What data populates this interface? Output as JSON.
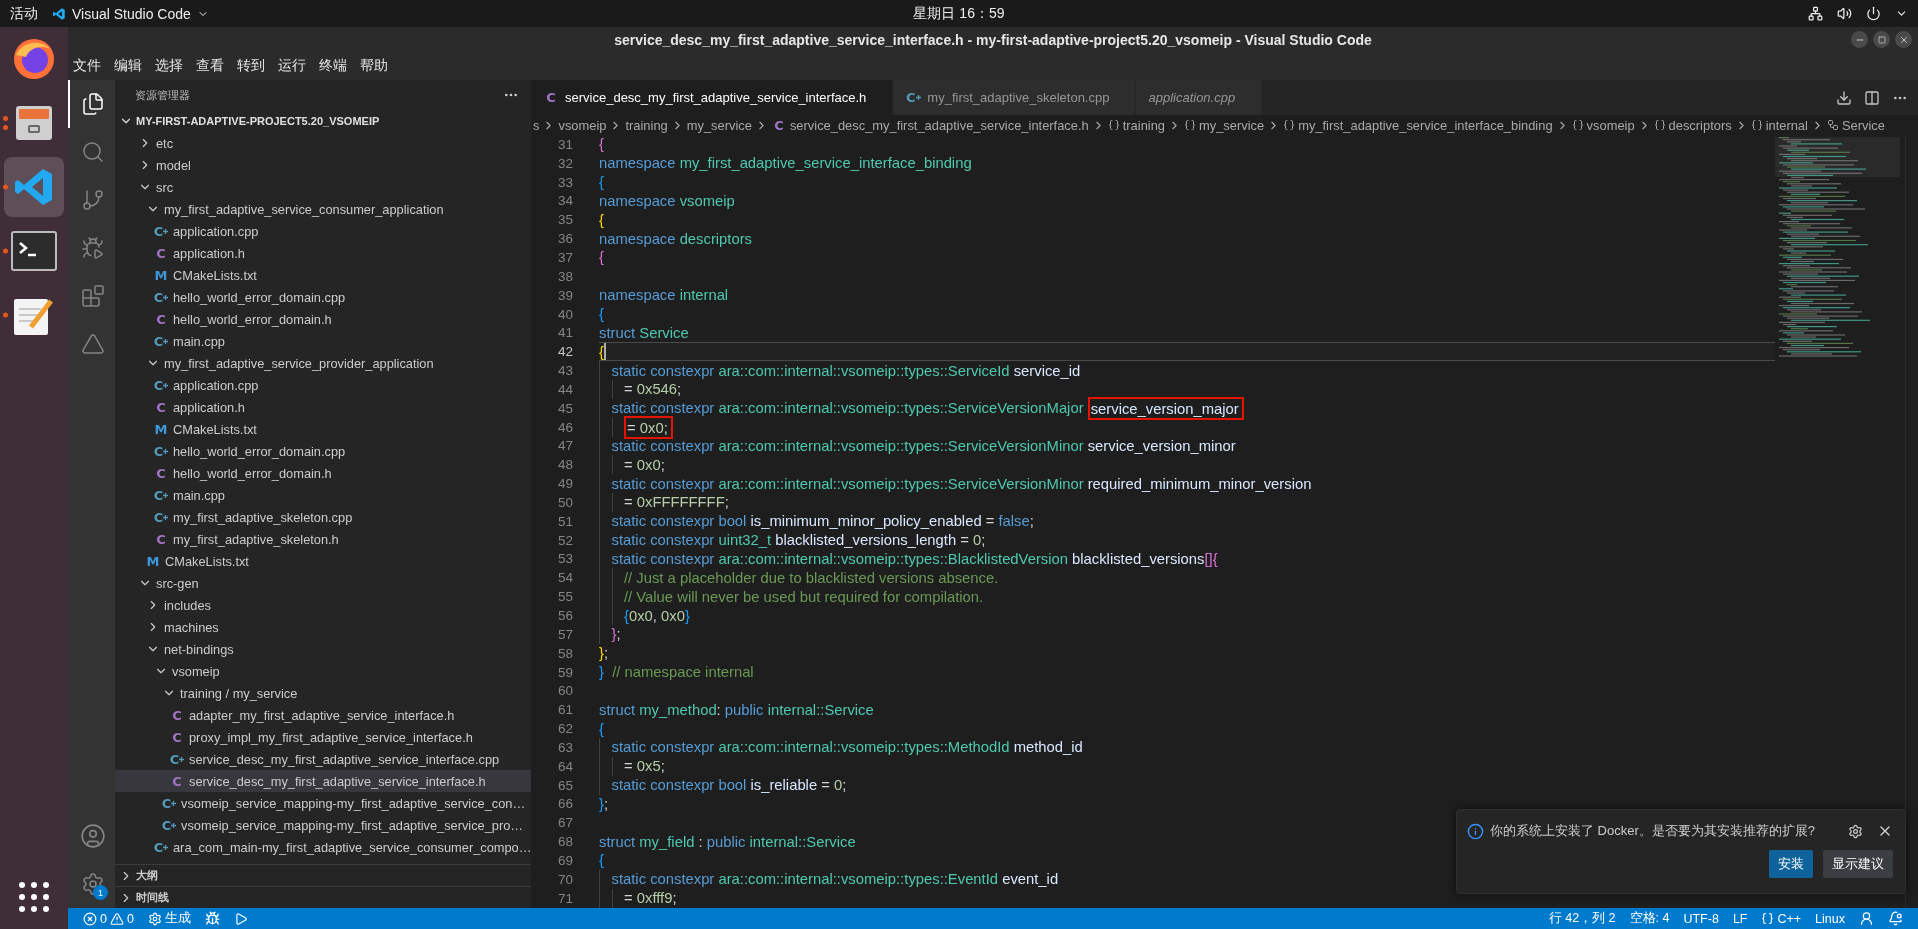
{
  "top_bar": {
    "activities": "活动",
    "app_name": "Visual Studio Code",
    "clock": "星期日 16：59"
  },
  "dock": [
    {
      "kind": "firefox",
      "selected": false,
      "running": false
    },
    {
      "kind": "files",
      "selected": false,
      "running": true,
      "multiple_windows": true
    },
    {
      "kind": "vscode",
      "selected": true,
      "running": true,
      "multiple_windows": false
    },
    {
      "kind": "terminal",
      "selected": false,
      "running": true,
      "multiple_windows": false
    },
    {
      "kind": "editor",
      "selected": false,
      "running": true,
      "multiple_windows": false
    }
  ],
  "window": {
    "title": "service_desc_my_first_adaptive_service_interface.h - my-first-adaptive-project5.20_vsomeip - Visual Studio Code",
    "menu": [
      "文件",
      "编辑",
      "选择",
      "查看",
      "转到",
      "运行",
      "终端",
      "帮助"
    ]
  },
  "activity_bar": {
    "items": [
      {
        "kind": "explorer",
        "selected": true
      },
      {
        "kind": "search",
        "selected": false
      },
      {
        "kind": "source_control",
        "selected": false
      },
      {
        "kind": "run_debug",
        "selected": false
      },
      {
        "kind": "extensions",
        "selected": false
      },
      {
        "kind": "triangle",
        "selected": false
      }
    ],
    "manage_badge": "1"
  },
  "sidebar": {
    "title": "资源管理器",
    "root": "MY-FIRST-ADAPTIVE-PROJECT5.20_VSOMEIP",
    "root_expanded": true,
    "tree": [
      {
        "label": "etc",
        "kind": "folder",
        "expanded": false,
        "selected": false
      },
      {
        "label": "model",
        "kind": "folder",
        "expanded": false,
        "selected": false
      },
      {
        "label": "src",
        "kind": "folder",
        "expanded": true,
        "selected": false,
        "children": [
          {
            "label": "my_first_adaptive_service_consumer_application",
            "kind": "folder",
            "expanded": true,
            "selected": false,
            "children": [
              {
                "label": "application.cpp",
                "kind": "cpp",
                "icon": "C",
                "selected": false
              },
              {
                "label": "application.h",
                "kind": "h",
                "icon": "C",
                "selected": false
              },
              {
                "label": "CMakeLists.txt",
                "kind": "cmake",
                "icon": "M",
                "selected": false
              },
              {
                "label": "hello_world_error_domain.cpp",
                "kind": "cpp",
                "icon": "C",
                "selected": false
              },
              {
                "label": "hello_world_error_domain.h",
                "kind": "h",
                "icon": "C",
                "selected": false
              },
              {
                "label": "main.cpp",
                "kind": "cpp",
                "icon": "C",
                "selected": false
              }
            ]
          },
          {
            "label": "my_first_adaptive_service_provider_application",
            "kind": "folder",
            "expanded": true,
            "selected": false,
            "children": [
              {
                "label": "application.cpp",
                "kind": "cpp",
                "icon": "C",
                "selected": false
              },
              {
                "label": "application.h",
                "kind": "h",
                "icon": "C",
                "selected": false
              },
              {
                "label": "CMakeLists.txt",
                "kind": "cmake",
                "icon": "M",
                "selected": false
              },
              {
                "label": "hello_world_error_domain.cpp",
                "kind": "cpp",
                "icon": "C",
                "selected": false
              },
              {
                "label": "hello_world_error_domain.h",
                "kind": "h",
                "icon": "C",
                "selected": false
              },
              {
                "label": "main.cpp",
                "kind": "cpp",
                "icon": "C",
                "selected": false
              },
              {
                "label": "my_first_adaptive_skeleton.cpp",
                "kind": "cpp",
                "icon": "C",
                "selected": false
              },
              {
                "label": "my_first_adaptive_skeleton.h",
                "kind": "h",
                "icon": "C",
                "selected": false
              }
            ]
          },
          {
            "label": "CMakeLists.txt",
            "kind": "cmake",
            "icon": "M",
            "selected": false
          }
        ]
      },
      {
        "label": "src-gen",
        "kind": "folder",
        "expanded": true,
        "selected": false,
        "children": [
          {
            "label": "includes",
            "kind": "folder",
            "expanded": false,
            "selected": false
          },
          {
            "label": "machines",
            "kind": "folder",
            "expanded": false,
            "selected": false
          },
          {
            "label": "net-bindings",
            "kind": "folder",
            "expanded": true,
            "selected": false,
            "children": [
              {
                "label": "vsomeip",
                "kind": "folder",
                "expanded": true,
                "selected": false,
                "children": [
                  {
                    "label": "training / my_service",
                    "kind": "folder",
                    "expanded": true,
                    "selected": false,
                    "children": [
                      {
                        "label": "adapter_my_first_adaptive_service_interface.h",
                        "kind": "h",
                        "icon": "C",
                        "selected": false
                      },
                      {
                        "label": "proxy_impl_my_first_adaptive_service_interface.h",
                        "kind": "h",
                        "icon": "C",
                        "selected": false
                      },
                      {
                        "label": "service_desc_my_first_adaptive_service_interface.cpp",
                        "kind": "cpp",
                        "icon": "C",
                        "selected": false
                      },
                      {
                        "label": "service_desc_my_first_adaptive_service_interface.h",
                        "kind": "h",
                        "icon": "C",
                        "selected": true
                      }
                    ]
                  },
                  {
                    "label": "vsomeip_service_mapping-my_first_adaptive_service_con…",
                    "kind": "cpp",
                    "icon": "C",
                    "selected": false
                  },
                  {
                    "label": "vsomeip_service_mapping-my_first_adaptive_service_pro…",
                    "kind": "cpp",
                    "icon": "C",
                    "selected": false
                  }
                ]
              },
              {
                "label": "ara_com_main-my_first_adaptive_service_consumer_compo…",
                "kind": "cpp",
                "icon": "C",
                "selected": false
              }
            ]
          }
        ]
      }
    ],
    "sections": [
      {
        "label": "大纲",
        "expanded": false
      },
      {
        "label": "时间线",
        "expanded": false
      }
    ]
  },
  "editor": {
    "tabs": [
      {
        "label": "service_desc_my_first_adaptive_service_interface.h",
        "kind": "h",
        "icon": "C",
        "selected": true,
        "preview": false
      },
      {
        "label": "my_first_adaptive_skeleton.cpp",
        "kind": "cpp",
        "icon": "C",
        "selected": false,
        "preview": false
      },
      {
        "label": "application.cpp",
        "kind": "cpp",
        "selected": false,
        "preview": true
      }
    ],
    "breadcrumbs": [
      {
        "label": "s",
        "kind": "folder"
      },
      {
        "label": "vsomeip",
        "kind": "folder"
      },
      {
        "label": "training",
        "kind": "folder"
      },
      {
        "label": "my_service",
        "kind": "folder"
      },
      {
        "label": "service_desc_my_first_adaptive_service_interface.h",
        "kind": "h_file",
        "icon": "C"
      },
      {
        "label": "training",
        "kind": "namespace"
      },
      {
        "label": "my_service",
        "kind": "namespace"
      },
      {
        "label": "my_first_adaptive_service_interface_binding",
        "kind": "namespace"
      },
      {
        "label": "vsomeip",
        "kind": "namespace"
      },
      {
        "label": "descriptors",
        "kind": "namespace"
      },
      {
        "label": "internal",
        "kind": "namespace"
      },
      {
        "label": "Service",
        "kind": "struct"
      }
    ],
    "lines": [
      {
        "number": "31",
        "current": false,
        "indented": false,
        "double_indented": false,
        "tokens": [
          {
            "kind": "br1",
            "text": "{"
          }
        ]
      },
      {
        "number": "32",
        "current": false,
        "indented": false,
        "double_indented": false,
        "tokens": [
          {
            "kind": "kw",
            "text": "namespace "
          },
          {
            "kind": "type",
            "text": "my_first_adaptive_service_interface_binding"
          }
        ]
      },
      {
        "number": "33",
        "current": false,
        "indented": false,
        "double_indented": false,
        "tokens": [
          {
            "kind": "br2",
            "text": "{"
          }
        ]
      },
      {
        "number": "34",
        "current": false,
        "indented": false,
        "double_indented": false,
        "tokens": [
          {
            "kind": "kw",
            "text": "namespace "
          },
          {
            "kind": "type",
            "text": "vsomeip"
          }
        ]
      },
      {
        "number": "35",
        "current": false,
        "indented": false,
        "double_indented": false,
        "tokens": [
          {
            "kind": "br3",
            "text": "{"
          }
        ]
      },
      {
        "number": "36",
        "current": false,
        "indented": false,
        "double_indented": false,
        "tokens": [
          {
            "kind": "kw",
            "text": "namespace "
          },
          {
            "kind": "type",
            "text": "descriptors"
          }
        ]
      },
      {
        "number": "37",
        "current": false,
        "indented": false,
        "double_indented": false,
        "tokens": [
          {
            "kind": "br1",
            "text": "{"
          }
        ]
      },
      {
        "number": "38",
        "current": false,
        "indented": false,
        "double_indented": false
      },
      {
        "number": "39",
        "current": false,
        "indented": false,
        "double_indented": false,
        "tokens": [
          {
            "kind": "kw",
            "text": "namespace "
          },
          {
            "kind": "type",
            "text": "internal"
          }
        ]
      },
      {
        "number": "40",
        "current": false,
        "indented": false,
        "double_indented": false,
        "tokens": [
          {
            "kind": "br2",
            "text": "{"
          }
        ]
      },
      {
        "number": "41",
        "current": false,
        "indented": false,
        "double_indented": false,
        "tokens": [
          {
            "kind": "kw",
            "text": "struct "
          },
          {
            "kind": "type",
            "text": "Service"
          }
        ]
      },
      {
        "number": "42",
        "current": true,
        "indented": false,
        "double_indented": false,
        "tokens": [
          {
            "kind": "br3",
            "text": "{"
          }
        ]
      },
      {
        "number": "43",
        "current": false,
        "indented": true,
        "double_indented": false,
        "tokens": [
          {
            "kind": "kw",
            "text": "static constexpr "
          },
          {
            "kind": "type",
            "text": "ara::com::internal::vsomeip::types::ServiceId "
          },
          {
            "kind": "ident",
            "text": "service_id"
          }
        ]
      },
      {
        "number": "44",
        "current": false,
        "indented": true,
        "double_indented": true,
        "tokens": [
          {
            "kind": "plain",
            "text": "= "
          },
          {
            "kind": "num",
            "text": "0x546"
          },
          {
            "kind": "plain",
            "text": ";"
          }
        ]
      },
      {
        "number": "45",
        "current": false,
        "indented": true,
        "double_indented": false,
        "tokens": [
          {
            "kind": "kw",
            "text": "static constexpr "
          },
          {
            "kind": "type",
            "text": "ara::com::internal::vsomeip::types::ServiceVersionMajor "
          },
          {
            "kind": "box",
            "parts": [
              {
                "kind": "ident",
                "text": "service_version_major"
              }
            ]
          }
        ]
      },
      {
        "number": "46",
        "current": false,
        "indented": true,
        "double_indented": true,
        "tokens": [
          {
            "kind": "box",
            "parts": [
              {
                "kind": "plain",
                "text": "= "
              },
              {
                "kind": "num",
                "text": "0x0"
              },
              {
                "kind": "plain",
                "text": ";"
              }
            ]
          }
        ]
      },
      {
        "number": "47",
        "current": false,
        "indented": true,
        "double_indented": false,
        "tokens": [
          {
            "kind": "kw",
            "text": "static constexpr "
          },
          {
            "kind": "type",
            "text": "ara::com::internal::vsomeip::types::ServiceVersionMinor "
          },
          {
            "kind": "ident",
            "text": "service_version_minor"
          }
        ]
      },
      {
        "number": "48",
        "current": false,
        "indented": true,
        "double_indented": true,
        "tokens": [
          {
            "kind": "plain",
            "text": "= "
          },
          {
            "kind": "num",
            "text": "0x0"
          },
          {
            "kind": "plain",
            "text": ";"
          }
        ]
      },
      {
        "number": "49",
        "current": false,
        "indented": true,
        "double_indented": false,
        "tokens": [
          {
            "kind": "kw",
            "text": "static constexpr "
          },
          {
            "kind": "type",
            "text": "ara::com::internal::vsomeip::types::ServiceVersionMinor "
          },
          {
            "kind": "ident",
            "text": "required_minimum_minor_version"
          }
        ]
      },
      {
        "number": "50",
        "current": false,
        "indented": true,
        "double_indented": true,
        "tokens": [
          {
            "kind": "plain",
            "text": "= "
          },
          {
            "kind": "num",
            "text": "0xFFFFFFFF"
          },
          {
            "kind": "plain",
            "text": ";"
          }
        ]
      },
      {
        "number": "51",
        "current": false,
        "indented": true,
        "double_indented": false,
        "tokens": [
          {
            "kind": "kw",
            "text": "static constexpr bool "
          },
          {
            "kind": "ident",
            "text": "is_minimum_minor_policy_enabled "
          },
          {
            "kind": "plain",
            "text": "= "
          },
          {
            "kind": "kw",
            "text": "false"
          },
          {
            "kind": "plain",
            "text": ";"
          }
        ]
      },
      {
        "number": "52",
        "current": false,
        "indented": true,
        "double_indented": false,
        "tokens": [
          {
            "kind": "kw",
            "text": "static constexpr "
          },
          {
            "kind": "type",
            "text": "uint32_t "
          },
          {
            "kind": "ident",
            "text": "blacklisted_versions_length "
          },
          {
            "kind": "plain",
            "text": "= "
          },
          {
            "kind": "num",
            "text": "0"
          },
          {
            "kind": "plain",
            "text": ";"
          }
        ]
      },
      {
        "number": "53",
        "current": false,
        "indented": true,
        "double_indented": false,
        "tokens": [
          {
            "kind": "kw",
            "text": "static constexpr "
          },
          {
            "kind": "type",
            "text": "ara::com::internal::vsomeip::types::BlacklistedVersion "
          },
          {
            "kind": "ident",
            "text": "blacklisted_versions"
          },
          {
            "kind": "br1",
            "text": "[]{"
          }
        ]
      },
      {
        "number": "54",
        "current": false,
        "indented": true,
        "double_indented": true,
        "tokens": [
          {
            "kind": "comment",
            "text": "// Just a placeholder due to blacklisted versions absence."
          }
        ]
      },
      {
        "number": "55",
        "current": false,
        "indented": true,
        "double_indented": true,
        "tokens": [
          {
            "kind": "comment",
            "text": "// Value will never be used but required for compilation."
          }
        ]
      },
      {
        "number": "56",
        "current": false,
        "indented": true,
        "double_indented": true,
        "tokens": [
          {
            "kind": "br2",
            "text": "{"
          },
          {
            "kind": "num",
            "text": "0x0"
          },
          {
            "kind": "plain",
            "text": ", "
          },
          {
            "kind": "num",
            "text": "0x0"
          },
          {
            "kind": "br2",
            "text": "}"
          }
        ]
      },
      {
        "number": "57",
        "current": false,
        "indented": true,
        "double_indented": false,
        "tokens": [
          {
            "kind": "br1",
            "text": "}"
          },
          {
            "kind": "plain",
            "text": ";"
          }
        ]
      },
      {
        "number": "58",
        "current": false,
        "indented": false,
        "double_indented": false,
        "tokens": [
          {
            "kind": "br3",
            "text": "}"
          },
          {
            "kind": "plain",
            "text": ";"
          }
        ]
      },
      {
        "number": "59",
        "current": false,
        "indented": false,
        "double_indented": false,
        "tokens": [
          {
            "kind": "br2",
            "text": "}"
          },
          {
            "kind": "comment",
            "text": "  // namespace internal"
          }
        ]
      },
      {
        "number": "60",
        "current": false,
        "indented": false,
        "double_indented": false
      },
      {
        "number": "61",
        "current": false,
        "indented": false,
        "double_indented": false,
        "tokens": [
          {
            "kind": "kw",
            "text": "struct "
          },
          {
            "kind": "type",
            "text": "my_method"
          },
          {
            "kind": "plain",
            "text": ": "
          },
          {
            "kind": "kw",
            "text": "public "
          },
          {
            "kind": "type",
            "text": "internal::Service"
          }
        ]
      },
      {
        "number": "62",
        "current": false,
        "indented": false,
        "double_indented": false,
        "tokens": [
          {
            "kind": "br2",
            "text": "{"
          }
        ]
      },
      {
        "number": "63",
        "current": false,
        "indented": true,
        "double_indented": false,
        "tokens": [
          {
            "kind": "kw",
            "text": "static constexpr "
          },
          {
            "kind": "type",
            "text": "ara::com::internal::vsomeip::types::MethodId "
          },
          {
            "kind": "ident",
            "text": "method_id"
          }
        ]
      },
      {
        "number": "64",
        "current": false,
        "indented": true,
        "double_indented": true,
        "tokens": [
          {
            "kind": "plain",
            "text": "= "
          },
          {
            "kind": "num",
            "text": "0x5"
          },
          {
            "kind": "plain",
            "text": ";"
          }
        ]
      },
      {
        "number": "65",
        "current": false,
        "indented": true,
        "double_indented": false,
        "tokens": [
          {
            "kind": "kw",
            "text": "static constexpr bool "
          },
          {
            "kind": "ident",
            "text": "is_reliable "
          },
          {
            "kind": "plain",
            "text": "= "
          },
          {
            "kind": "num",
            "text": "0"
          },
          {
            "kind": "plain",
            "text": ";"
          }
        ]
      },
      {
        "number": "66",
        "current": false,
        "indented": false,
        "double_indented": false,
        "tokens": [
          {
            "kind": "br2",
            "text": "}"
          },
          {
            "kind": "plain",
            "text": ";"
          }
        ]
      },
      {
        "number": "67",
        "current": false,
        "indented": false,
        "double_indented": false
      },
      {
        "number": "68",
        "current": false,
        "indented": false,
        "double_indented": false,
        "tokens": [
          {
            "kind": "kw",
            "text": "struct "
          },
          {
            "kind": "type",
            "text": "my_field "
          },
          {
            "kind": "plain",
            "text": ": "
          },
          {
            "kind": "kw",
            "text": "public "
          },
          {
            "kind": "type",
            "text": "internal::Service"
          }
        ]
      },
      {
        "number": "69",
        "current": false,
        "indented": false,
        "double_indented": false,
        "tokens": [
          {
            "kind": "br2",
            "text": "{"
          }
        ]
      },
      {
        "number": "70",
        "current": false,
        "indented": true,
        "double_indented": false,
        "tokens": [
          {
            "kind": "kw",
            "text": "static constexpr "
          },
          {
            "kind": "type",
            "text": "ara::com::internal::vsomeip::types::EventId "
          },
          {
            "kind": "ident",
            "text": "event_id"
          }
        ]
      },
      {
        "number": "71",
        "current": false,
        "indented": true,
        "double_indented": true,
        "tokens": [
          {
            "kind": "plain",
            "text": "= "
          },
          {
            "kind": "num",
            "text": "0xfff9"
          },
          {
            "kind": "plain",
            "text": ";"
          }
        ]
      }
    ]
  },
  "notification": {
    "message": "你的系统上安装了 Docker。是否要为其安装推荐的扩展?",
    "buttons": [
      {
        "label": "安装",
        "kind": "primary"
      },
      {
        "label": "显示建议",
        "kind": "secondary"
      }
    ]
  },
  "status_bar": {
    "left": [
      {
        "kind": "problems",
        "errors": "0",
        "warnings": "0"
      },
      {
        "kind": "build",
        "label": "生成"
      },
      {
        "kind": "debug"
      },
      {
        "kind": "run"
      }
    ],
    "right": [
      {
        "kind": "text",
        "label": "行 42，列 2"
      },
      {
        "kind": "text",
        "label": "空格: 4"
      },
      {
        "kind": "text",
        "label": "UTF-8"
      },
      {
        "kind": "text",
        "label": "LF"
      },
      {
        "kind": "language",
        "label": "C++"
      },
      {
        "kind": "text",
        "label": "Linux"
      },
      {
        "kind": "feedback"
      },
      {
        "kind": "notifications"
      }
    ]
  }
}
